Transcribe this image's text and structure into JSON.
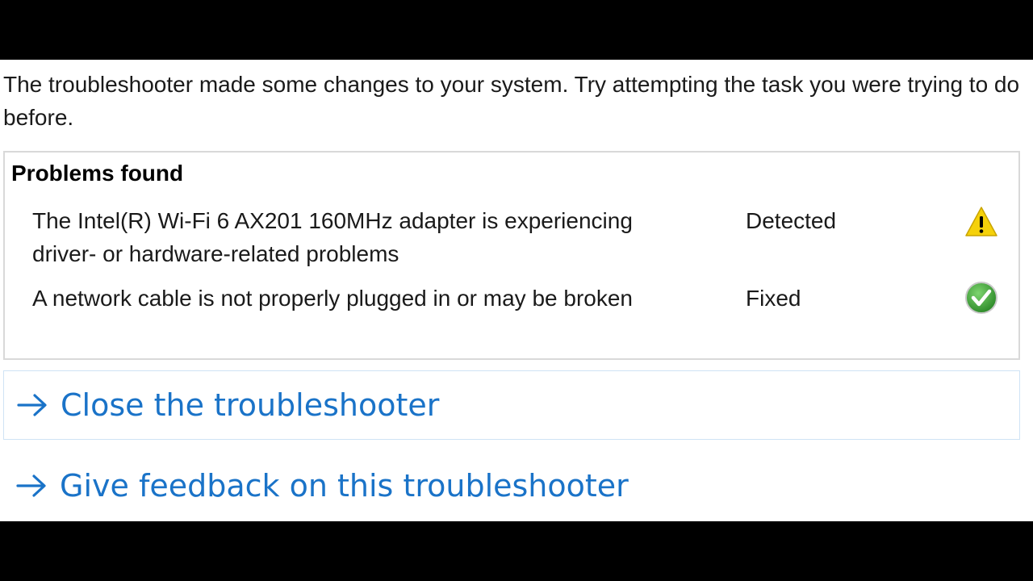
{
  "intro_text": "The troubleshooter made some changes to your system. Try attempting the task you were trying to do before.",
  "problems": {
    "title": "Problems found",
    "items": [
      {
        "description": "The Intel(R) Wi-Fi 6 AX201 160MHz adapter is experiencing driver- or hardware-related problems",
        "status": "Detected",
        "icon": "warning-icon"
      },
      {
        "description": "A network cable is not properly plugged in or may be broken",
        "status": "Fixed",
        "icon": "check-icon"
      }
    ]
  },
  "actions": {
    "close_label": "Close the troubleshooter",
    "feedback_label": "Give feedback on this troubleshooter",
    "arrow_icon": "arrow-right-icon"
  },
  "colors": {
    "link": "#1a73c8",
    "warning": "#f5d10a",
    "success": "#3aa935"
  }
}
